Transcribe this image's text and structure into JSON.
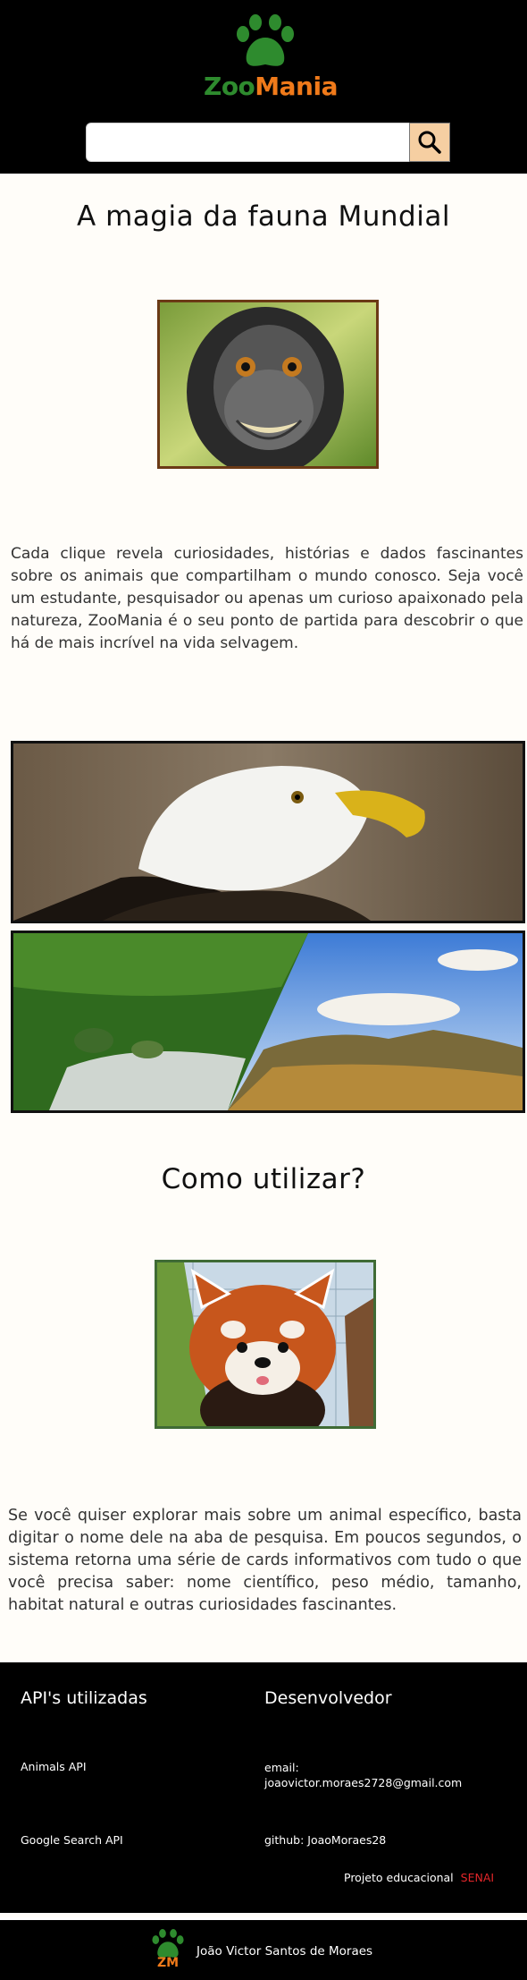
{
  "brand": {
    "name_part1": "Zoo",
    "name_part2": "Mania"
  },
  "search": {
    "placeholder": ""
  },
  "hero": {
    "title": "A magia da fauna Mundial",
    "paragraph": "Cada clique revela curiosidades, histórias e dados fascinantes sobre os animais que compartilham o mundo conosco. Seja você um estudante, pesquisador ou apenas um curioso apaixonado pela natureza, ZooMania é o seu ponto de partida para descobrir o que há de mais incrível na vida selvagem."
  },
  "howto": {
    "title": "Como utilizar?",
    "paragraph": "Se você quiser explorar mais sobre um animal específico, basta digitar o nome dele na aba de pesquisa. Em poucos segundos, o sistema retorna uma série de cards informativos com tudo o que você precisa saber: nome científico, peso médio, tamanho, habitat natural e outras curiosidades fascinantes."
  },
  "footer": {
    "apis_title": "API's utilizadas",
    "api1": "Animals API",
    "api2": "Google Search API",
    "dev_title": "Desenvolvedor",
    "email_label": "email:",
    "email": "joaovictor.moraes2728@gmail.com",
    "github": "github: JoaoMoraes28",
    "project_label": "Projeto educacional",
    "project_org": "SENAI"
  },
  "bottom": {
    "badge": "ZM",
    "author": "João Victor Santos de Moraes"
  },
  "colors": {
    "green": "#2e8b2e",
    "orange": "#f07a1a",
    "senai_red": "#e3262a",
    "search_button": "#f6cfa2"
  },
  "icons": [
    "paw-icon",
    "search-icon"
  ]
}
